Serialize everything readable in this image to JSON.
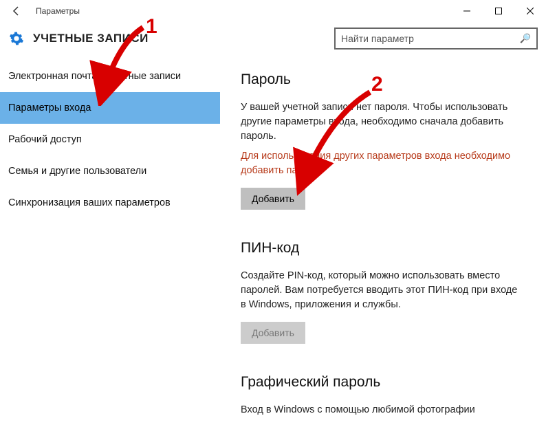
{
  "app_title": "Параметры",
  "page_title": "УЧЕТНЫЕ ЗАПИСИ",
  "search": {
    "placeholder": "Найти параметр"
  },
  "sidebar": {
    "items": [
      {
        "label": "Электронная почта и учетные записи"
      },
      {
        "label": "Параметры входа"
      },
      {
        "label": "Рабочий доступ"
      },
      {
        "label": "Семья и другие пользователи"
      },
      {
        "label": "Синхронизация ваших параметров"
      }
    ],
    "selected_index": 1
  },
  "sections": {
    "password": {
      "title": "Пароль",
      "desc": "У вашей учетной записи нет пароля. Чтобы использовать другие параметры входа, необходимо сначала добавить пароль.",
      "warn": "Для использования других параметров входа необходимо добавить пароль.",
      "button": "Добавить"
    },
    "pin": {
      "title": "ПИН-код",
      "desc": "Создайте PIN-код, который можно использовать вместо паролей. Вам потребуется вводить этот ПИН-код при входе в Windows, приложения и службы.",
      "button": "Добавить"
    },
    "picture": {
      "title": "Графический пароль",
      "desc": "Вход в Windows с помощью любимой фотографии"
    }
  },
  "annotations": {
    "n1": "1",
    "n2": "2"
  }
}
